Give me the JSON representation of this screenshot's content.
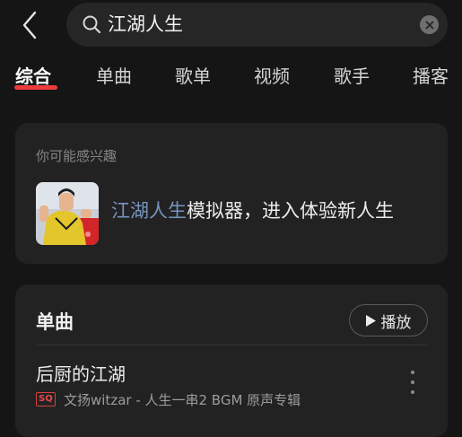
{
  "search": {
    "query": "江湖人生"
  },
  "tabs": [
    {
      "label": "综合",
      "active": true
    },
    {
      "label": "单曲"
    },
    {
      "label": "歌单"
    },
    {
      "label": "视频"
    },
    {
      "label": "歌手"
    },
    {
      "label": "播客"
    }
  ],
  "interest": {
    "label": "你可能感兴趣",
    "title_highlight": "江湖人生",
    "title_rest": "模拟器，进入体验新人生"
  },
  "songs": {
    "title": "单曲",
    "play_label": "播放",
    "items": [
      {
        "title": "后厨的江湖",
        "quality_badge": "SQ",
        "subtitle": "文扬witzar - 人生一串2 BGM 原声专辑"
      }
    ]
  },
  "colors": {
    "accent": "#ee3b3b",
    "highlight": "#7794bf",
    "background": "#151515",
    "card": "#222222"
  },
  "icons": {
    "back": "chevron-left-icon",
    "search": "search-icon",
    "clear": "close-icon",
    "play": "play-icon",
    "more": "more-vertical-icon"
  }
}
